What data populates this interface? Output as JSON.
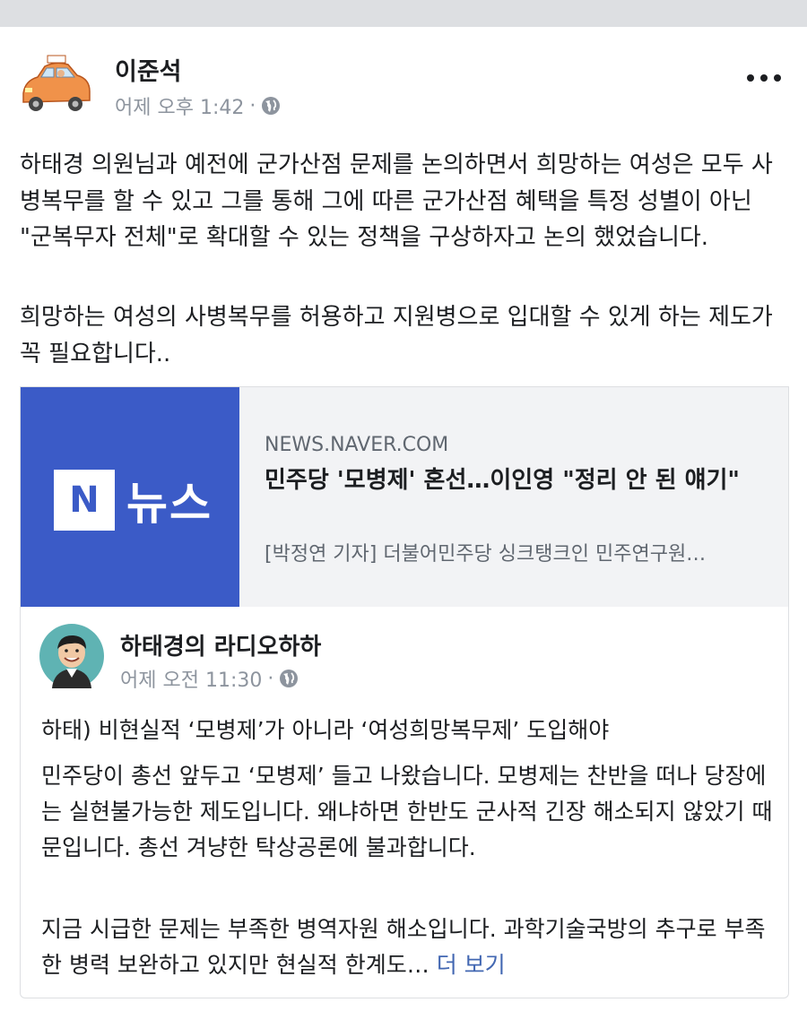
{
  "post": {
    "author": "이준석",
    "timestamp": "어제 오후 1:42",
    "meta_separator": "·",
    "privacy_icon": "globe-icon",
    "menu_icon": "more-horizontal-icon",
    "paragraphs": [
      "하태경 의원님과 예전에 군가산점 문제를 논의하면서 희망하는 여성은 모두 사병복무를 할 수 있고 그를 통해 그에 따른 군가산점 혜택을 특정 성별이 아닌 \"군복무자 전체\"로 확대할 수 있는 정책을 구상하자고 논의 했었습니다.",
      "희망하는 여성의 사병복무를 허용하고 지원병으로 입대할 수 있게 하는 제도가 꼭 필요합니다.."
    ]
  },
  "link_preview": {
    "thumb_letter": "N",
    "thumb_text": "뉴스",
    "domain": "NEWS.NAVER.COM",
    "title": "민주당 '모병제' 혼선…이인영 \"정리 안 된 얘기\"",
    "description": "[박정연 기자] 더불어민주당 싱크탱크인 민주연구원…",
    "thumb_color": "#3b5bc7"
  },
  "shared_post": {
    "author": "하태경의 라디오하하",
    "timestamp": "어제 오전 11:30",
    "meta_separator": "·",
    "privacy_icon": "globe-icon",
    "paragraphs": [
      "하태) 비현실적 ‘모병제’가 아니라 ‘여성희망복무제’ 도입해야",
      "민주당이 총선 앞두고 ‘모병제’ 들고 나왔습니다. 모병제는 찬반을 떠나 당장에는 실현불가능한 제도입니다. 왜냐하면 한반도 군사적 긴장 해소되지 않았기 때문입니다. 총선 겨냥한 탁상공론에 불과합니다.",
      "지금 시급한 문제는 부족한 병역자원 해소입니다. 과학기술국방의 추구로 부족한 병력 보완하고 있지만 현실적 한계도… "
    ],
    "see_more": "더 보기"
  },
  "colors": {
    "link_blue": "#4267b2",
    "meta_gray": "#8d949e",
    "text": "#1c1e21",
    "card_bg": "#f2f3f5"
  }
}
